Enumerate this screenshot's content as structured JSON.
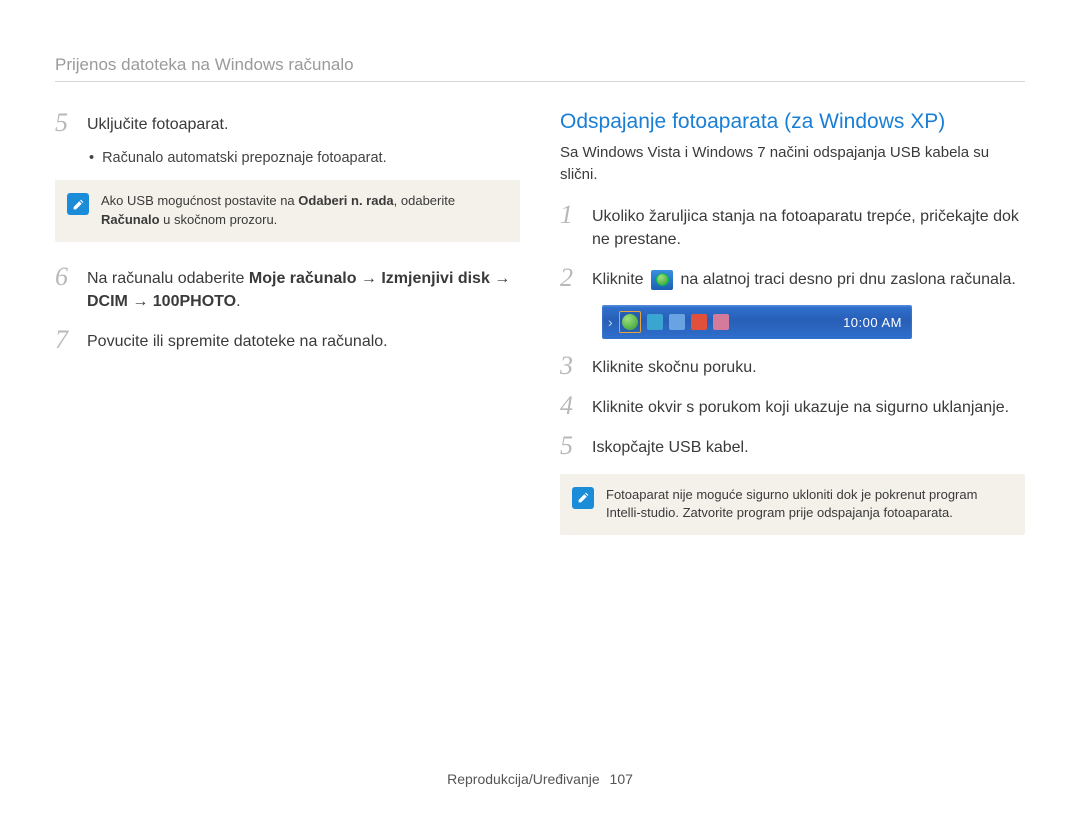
{
  "header": {
    "title": "Prijenos datoteka na Windows računalo"
  },
  "left": {
    "step5": {
      "num": "5",
      "text": "Uključite fotoaparat."
    },
    "step5_sub": {
      "dot": "•",
      "text": "Računalo automatski prepoznaje fotoaparat."
    },
    "note": {
      "pre": "Ako USB mogućnost postavite na ",
      "bold1": "Odaberi n. rada",
      "mid": ", odaberite ",
      "bold2": "Računalo",
      "post": " u skočnom prozoru."
    },
    "step6": {
      "num": "6",
      "pre": "Na računalu odaberite ",
      "bold": "Moje računalo → Izmjenjivi disk → DCIM → 100PHOTO",
      "post": "."
    },
    "step7": {
      "num": "7",
      "text": "Povucite ili spremite datoteke na računalo."
    }
  },
  "right": {
    "section_title": "Odspajanje fotoaparata (za Windows XP)",
    "intro": "Sa Windows Vista i Windows 7 načini odspajanja USB kabela su slični.",
    "step1": {
      "num": "1",
      "text": "Ukoliko žaruljica stanja na fotoaparatu trepće, pričekajte dok ne prestane."
    },
    "step2": {
      "num": "2",
      "pre": "Kliknite ",
      "post": " na alatnoj traci desno pri dnu zaslona računala."
    },
    "taskbar": {
      "time": "10:00 AM"
    },
    "step3": {
      "num": "3",
      "text": "Kliknite skočnu poruku."
    },
    "step4": {
      "num": "4",
      "text": "Kliknite okvir s porukom koji ukazuje na sigurno uklanjanje."
    },
    "step5": {
      "num": "5",
      "text": "Iskopčajte USB kabel."
    },
    "note": {
      "text": "Fotoaparat nije moguće sigurno ukloniti dok je pokrenut program Intelli-studio. Zatvorite program prije odspajanja fotoaparata."
    }
  },
  "footer": {
    "section": "Reprodukcija/Uređivanje",
    "page": "107"
  }
}
